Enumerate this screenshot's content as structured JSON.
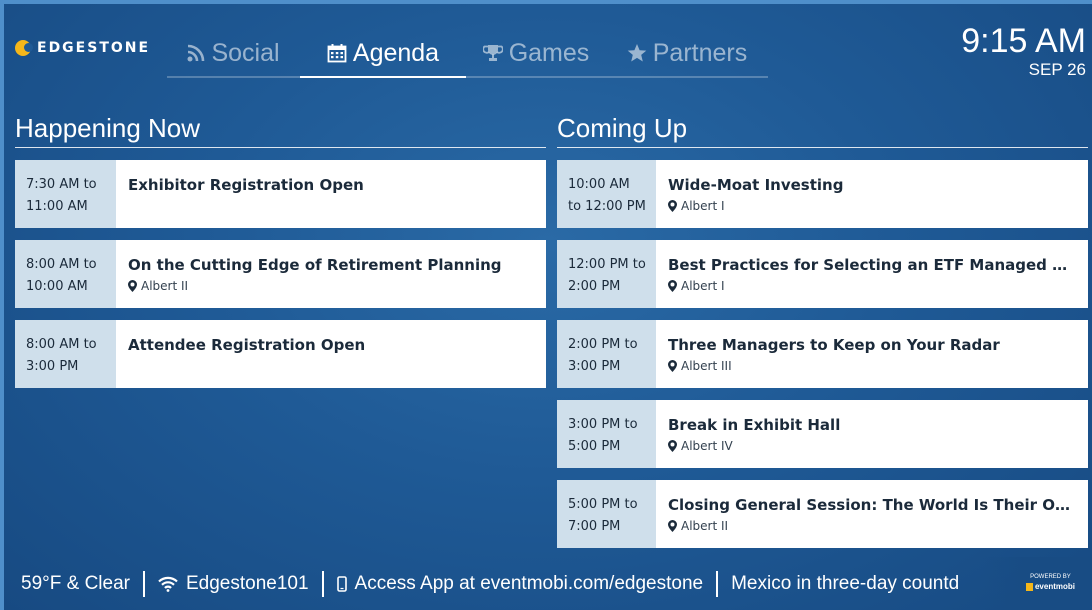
{
  "brand": {
    "name": "EDGESTONE",
    "logo_color": "#f5b71a"
  },
  "nav": {
    "tabs": [
      {
        "label": "Social",
        "icon": "rss-icon",
        "active": false
      },
      {
        "label": "Agenda",
        "icon": "calendar-icon",
        "active": true
      },
      {
        "label": "Games",
        "icon": "trophy-icon",
        "active": false
      },
      {
        "label": "Partners",
        "icon": "star-icon",
        "active": false
      }
    ]
  },
  "clock": {
    "time": "9:15 AM",
    "date": "SEP 26"
  },
  "happening_now": {
    "title": "Happening Now",
    "items": [
      {
        "start": "7:30 AM to",
        "end": "11:00 AM",
        "title": "Exhibitor Registration Open",
        "location": ""
      },
      {
        "start": "8:00 AM to",
        "end": "10:00 AM",
        "title": "On the Cutting Edge of Retirement Planning",
        "location": "Albert II"
      },
      {
        "start": "8:00 AM to",
        "end": "3:00 PM",
        "title": "Attendee Registration Open",
        "location": ""
      }
    ]
  },
  "coming_up": {
    "title": "Coming Up",
    "items": [
      {
        "start": "10:00 AM",
        "end": "to 12:00 PM",
        "title": "Wide-Moat Investing",
        "location": "Albert I"
      },
      {
        "start": "12:00 PM to",
        "end": "2:00 PM",
        "title": "Best Practices for Selecting an ETF Managed Portfol...",
        "location": "Albert I"
      },
      {
        "start": "2:00 PM to",
        "end": "3:00 PM",
        "title": "Three Managers to Keep on Your Radar",
        "location": "Albert III"
      },
      {
        "start": "3:00 PM to",
        "end": "5:00 PM",
        "title": "Break in Exhibit Hall",
        "location": "Albert IV"
      },
      {
        "start": "5:00 PM to",
        "end": "7:00 PM",
        "title": "Closing General Session: The World Is Their Oyster",
        "location": "Albert II"
      }
    ]
  },
  "footer": {
    "weather": "59°F & Clear",
    "wifi": "Edgestone101",
    "app": "Access App at eventmobi.com/edgestone",
    "ticker": "Mexico in three-day countd",
    "powered_by": "POWERED BY",
    "powered_brand": "eventmobi"
  },
  "colors": {
    "background": "#1f5a96",
    "time_cell": "#cfdfeb",
    "card": "#ffffff",
    "accent": "#f5b71a"
  }
}
